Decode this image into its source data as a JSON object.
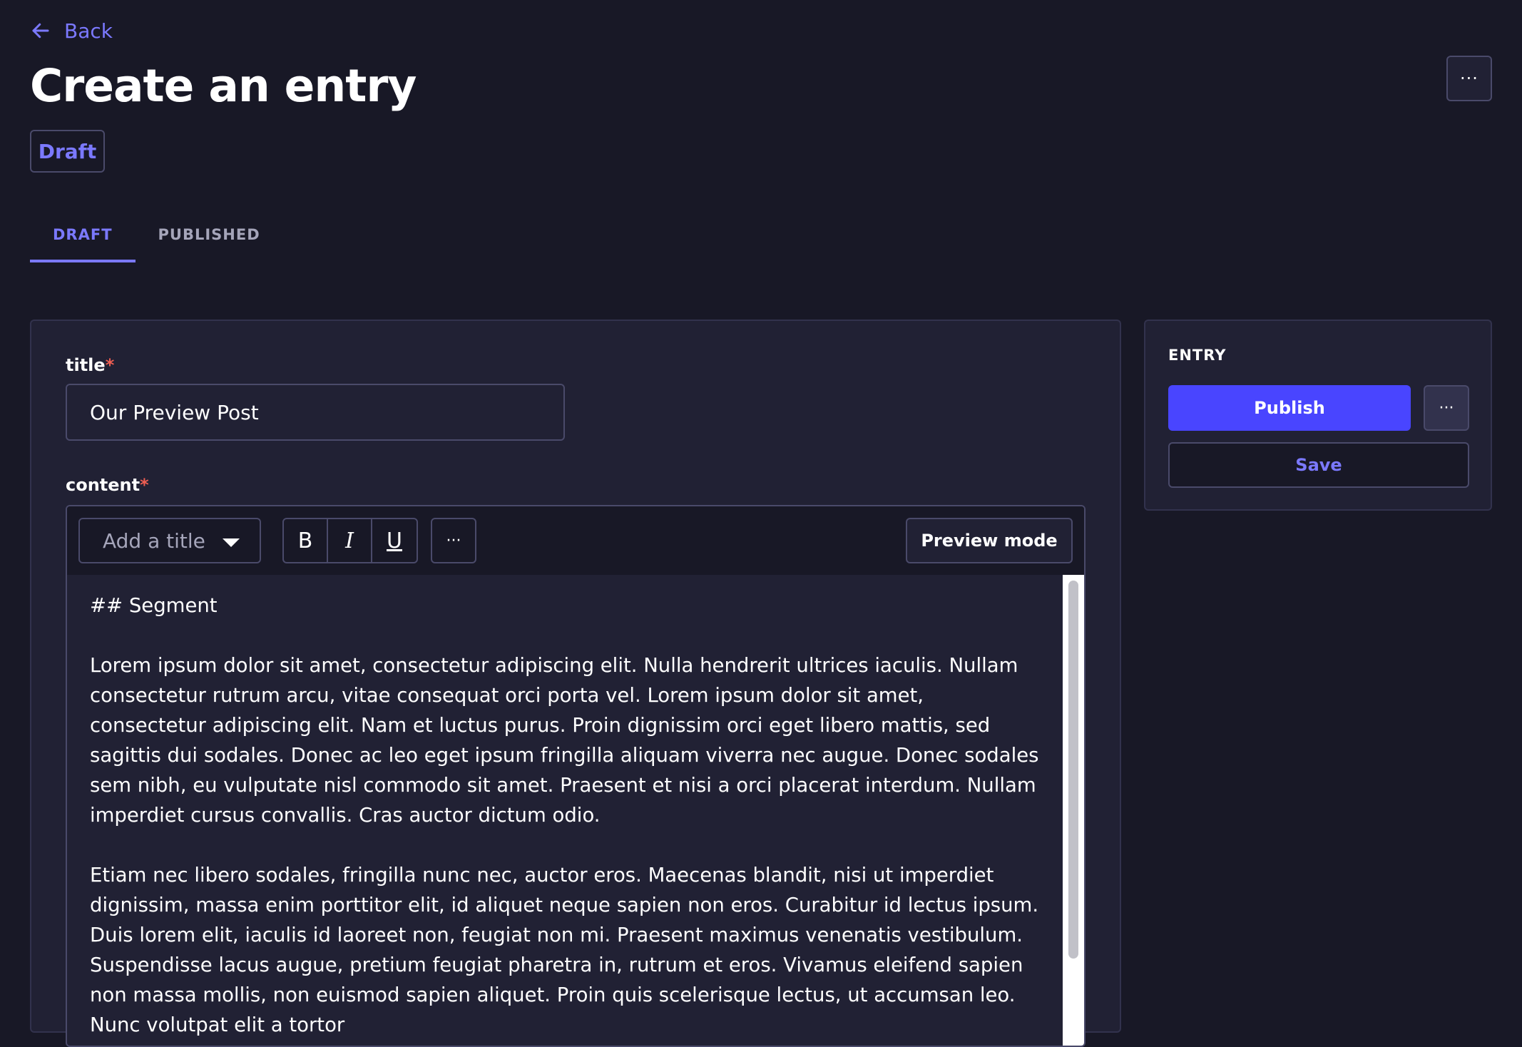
{
  "header": {
    "back_label": "Back",
    "title": "Create an entry",
    "more_glyph": "···",
    "status_badge": "Draft"
  },
  "tabs": [
    {
      "label": "DRAFT",
      "active": true
    },
    {
      "label": "PUBLISHED",
      "active": false
    }
  ],
  "form": {
    "title_field": {
      "label": "title",
      "required_mark": "*",
      "value": "Our Preview Post"
    },
    "content_field": {
      "label": "content",
      "required_mark": "*",
      "toolbar": {
        "heading_select_placeholder": "Add a title",
        "bold_label": "B",
        "italic_label": "I",
        "underline_label": "U",
        "more_glyph": "···",
        "preview_label": "Preview mode"
      },
      "paragraphs": [
        "## Segment",
        "Lorem ipsum dolor sit amet, consectetur adipiscing elit. Nulla hendrerit ultrices iaculis. Nullam consectetur rutrum arcu, vitae consequat orci porta vel. Lorem ipsum dolor sit amet, consectetur adipiscing elit. Nam et luctus purus. Proin dignissim orci eget libero mattis, sed sagittis dui sodales. Donec ac leo eget ipsum fringilla aliquam viverra nec augue. Donec sodales sem nibh, eu vulputate nisl commodo sit amet. Praesent et nisi a orci placerat interdum. Nullam imperdiet cursus convallis. Cras auctor dictum odio.",
        "Etiam nec libero sodales, fringilla nunc nec, auctor eros. Maecenas blandit, nisi ut imperdiet dignissim, massa enim porttitor elit, id aliquet neque sapien non eros. Curabitur id lectus ipsum. Duis lorem elit, iaculis id laoreet non, feugiat non mi. Praesent maximus venenatis vestibulum. Suspendisse lacus augue, pretium feugiat pharetra in, rutrum et eros. Vivamus eleifend sapien non massa mollis, non euismod sapien aliquet. Proin quis scelerisque lectus, ut accumsan leo. Nunc volutpat elit a tortor"
      ]
    }
  },
  "sidebar": {
    "heading": "ENTRY",
    "publish_label": "Publish",
    "more_glyph": "···",
    "save_label": "Save"
  },
  "colors": {
    "background": "#181826",
    "panel": "#212134",
    "accent": "#7b79ff",
    "primary_button": "#4945ff",
    "required": "#ee5e52",
    "border": "#4a4a6a"
  },
  "icons": {
    "back": "arrow-left-icon",
    "more": "more-horizontal-icon",
    "dropdown": "caret-down-icon"
  }
}
